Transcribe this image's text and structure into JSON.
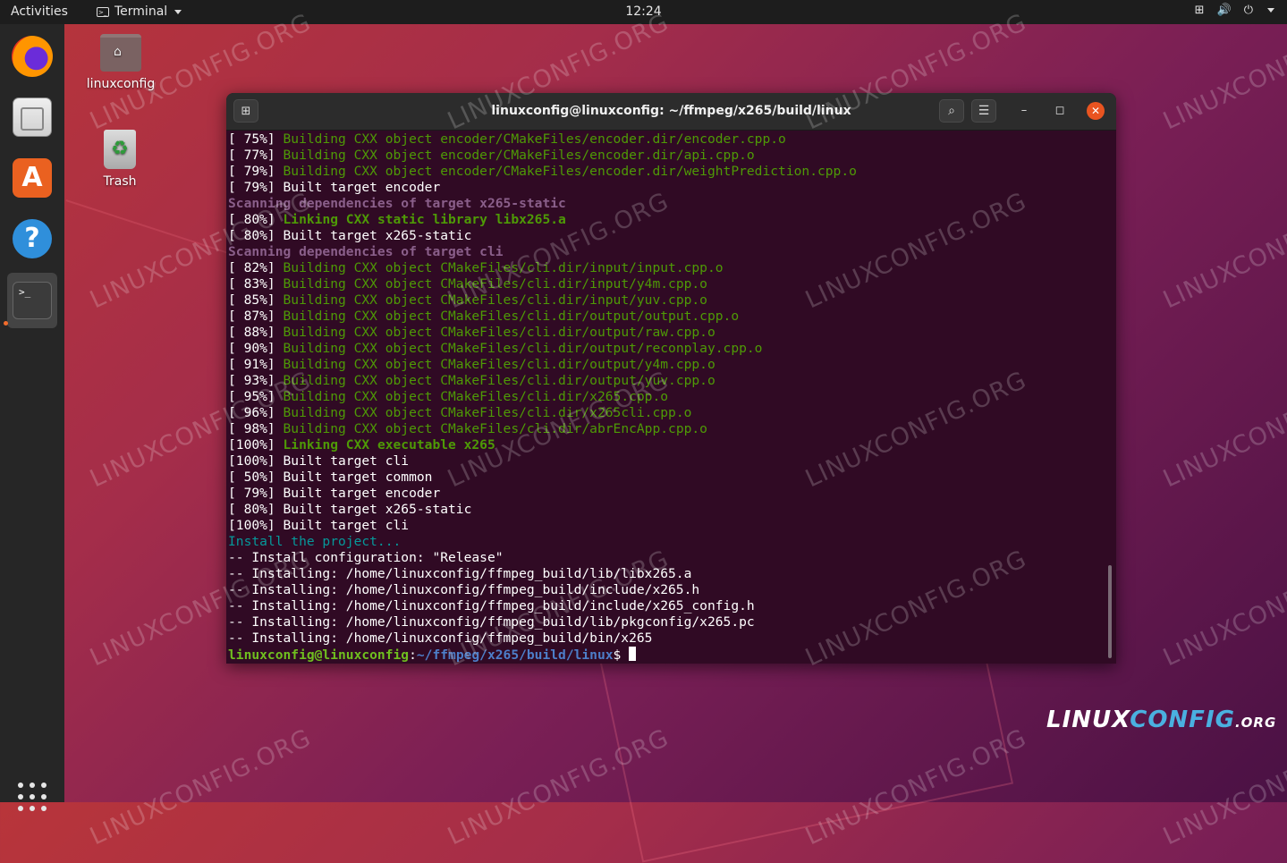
{
  "topbar": {
    "activities": "Activities",
    "app_name": "Terminal",
    "clock": "12:24"
  },
  "dock": {
    "items": [
      "firefox-icon",
      "files-icon",
      "software-icon",
      "help-icon",
      "terminal-icon"
    ],
    "show_apps": "show-apps-icon"
  },
  "desktop": {
    "home_label": "linuxconfig",
    "trash_label": "Trash"
  },
  "window": {
    "title": "linuxconfig@linuxconfig: ~/ffmpeg/x265/build/linux",
    "new_tab": "⊞",
    "search": "🔍",
    "menu": "☰",
    "minimize": "–",
    "maximize": "◻",
    "close": "✕"
  },
  "terminal": {
    "lines": [
      {
        "p": "[ 75%] ",
        "t": "Building CXX object encoder/CMakeFiles/encoder.dir/encoder.cpp.o",
        "c": "green"
      },
      {
        "p": "[ 77%] ",
        "t": "Building CXX object encoder/CMakeFiles/encoder.dir/api.cpp.o",
        "c": "green"
      },
      {
        "p": "[ 79%] ",
        "t": "Building CXX object encoder/CMakeFiles/encoder.dir/weightPrediction.cpp.o",
        "c": "green"
      },
      {
        "p": "[ 79%] ",
        "t": "Built target encoder",
        "c": ""
      },
      {
        "p": "",
        "t": "Scanning dependencies of target x265-static",
        "c": "purple"
      },
      {
        "p": "[ 80%] ",
        "t": "Linking CXX static library libx265.a",
        "c": "bgreen"
      },
      {
        "p": "[ 80%] ",
        "t": "Built target x265-static",
        "c": ""
      },
      {
        "p": "",
        "t": "Scanning dependencies of target cli",
        "c": "purple"
      },
      {
        "p": "[ 82%] ",
        "t": "Building CXX object CMakeFiles/cli.dir/input/input.cpp.o",
        "c": "green"
      },
      {
        "p": "[ 83%] ",
        "t": "Building CXX object CMakeFiles/cli.dir/input/y4m.cpp.o",
        "c": "green"
      },
      {
        "p": "[ 85%] ",
        "t": "Building CXX object CMakeFiles/cli.dir/input/yuv.cpp.o",
        "c": "green"
      },
      {
        "p": "[ 87%] ",
        "t": "Building CXX object CMakeFiles/cli.dir/output/output.cpp.o",
        "c": "green"
      },
      {
        "p": "[ 88%] ",
        "t": "Building CXX object CMakeFiles/cli.dir/output/raw.cpp.o",
        "c": "green"
      },
      {
        "p": "[ 90%] ",
        "t": "Building CXX object CMakeFiles/cli.dir/output/reconplay.cpp.o",
        "c": "green"
      },
      {
        "p": "[ 91%] ",
        "t": "Building CXX object CMakeFiles/cli.dir/output/y4m.cpp.o",
        "c": "green"
      },
      {
        "p": "[ 93%] ",
        "t": "Building CXX object CMakeFiles/cli.dir/output/yuv.cpp.o",
        "c": "green"
      },
      {
        "p": "[ 95%] ",
        "t": "Building CXX object CMakeFiles/cli.dir/x265.cpp.o",
        "c": "green"
      },
      {
        "p": "[ 96%] ",
        "t": "Building CXX object CMakeFiles/cli.dir/x265cli.cpp.o",
        "c": "green"
      },
      {
        "p": "[ 98%] ",
        "t": "Building CXX object CMakeFiles/cli.dir/abrEncApp.cpp.o",
        "c": "green"
      },
      {
        "p": "[100%] ",
        "t": "Linking CXX executable x265",
        "c": "bgreen"
      },
      {
        "p": "[100%] ",
        "t": "Built target cli",
        "c": ""
      },
      {
        "p": "[ 50%] ",
        "t": "Built target common",
        "c": ""
      },
      {
        "p": "[ 79%] ",
        "t": "Built target encoder",
        "c": ""
      },
      {
        "p": "[ 80%] ",
        "t": "Built target x265-static",
        "c": ""
      },
      {
        "p": "[100%] ",
        "t": "Built target cli",
        "c": ""
      },
      {
        "p": "",
        "t": "Install the project...",
        "c": "cyan"
      },
      {
        "p": "",
        "t": "-- Install configuration: \"Release\"",
        "c": ""
      },
      {
        "p": "",
        "t": "-- Installing: /home/linuxconfig/ffmpeg_build/lib/libx265.a",
        "c": ""
      },
      {
        "p": "",
        "t": "-- Installing: /home/linuxconfig/ffmpeg_build/include/x265.h",
        "c": ""
      },
      {
        "p": "",
        "t": "-- Installing: /home/linuxconfig/ffmpeg_build/include/x265_config.h",
        "c": ""
      },
      {
        "p": "",
        "t": "-- Installing: /home/linuxconfig/ffmpeg_build/lib/pkgconfig/x265.pc",
        "c": ""
      },
      {
        "p": "",
        "t": "-- Installing: /home/linuxconfig/ffmpeg_build/bin/x265",
        "c": ""
      }
    ],
    "prompt_user": "linuxconfig@linuxconfig",
    "prompt_sep": ":",
    "prompt_path": "~/ffmpeg/x265/build/linux",
    "prompt_symbol": "$ "
  },
  "watermark": "LINUXCONFIG.ORG",
  "logo": {
    "a": "LINUX",
    "b": "CONFIG",
    ".org": ".ORG"
  }
}
